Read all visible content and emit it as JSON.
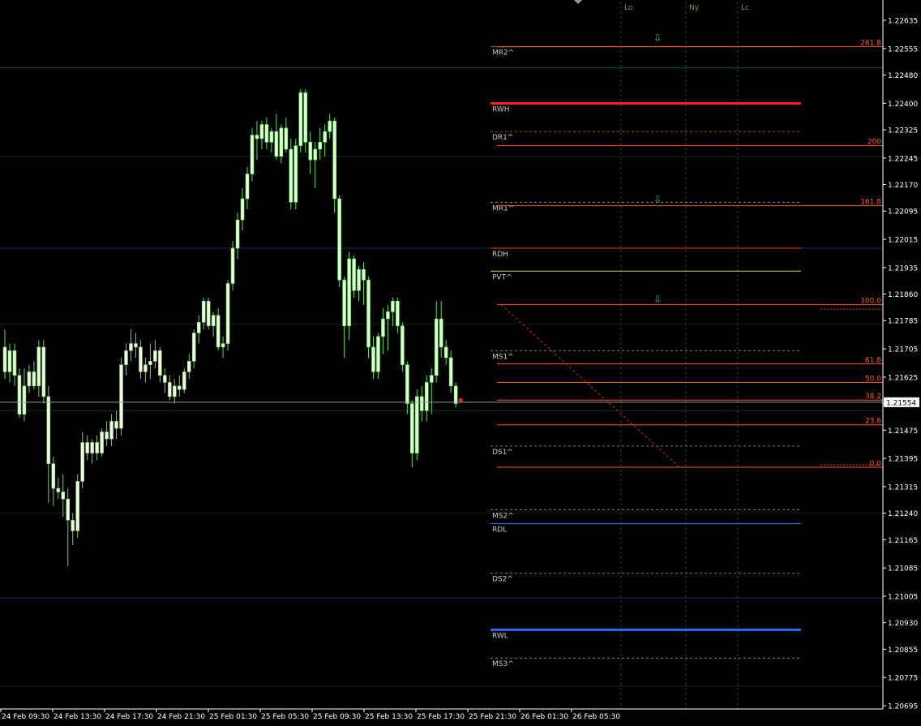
{
  "chart_data": {
    "type": "candlestick",
    "instrument_note": "",
    "price_axis": {
      "ticks": [
        "1.22635",
        "1.22555",
        "1.22480",
        "1.22400",
        "1.22325",
        "1.22245",
        "1.22170",
        "1.22095",
        "1.22015",
        "1.21935",
        "1.21860",
        "1.21785",
        "1.21705",
        "1.21625",
        "1.21550",
        "1.21475",
        "1.21395",
        "1.21315",
        "1.21240",
        "1.21165",
        "1.21085",
        "1.21005",
        "1.20930",
        "1.20855",
        "1.20775",
        "1.20695"
      ],
      "range": [
        1.20695,
        1.22635
      ]
    },
    "time_axis": {
      "ticks": [
        "24 Feb 09:30",
        "24 Feb 13:30",
        "24 Feb 17:30",
        "24 Feb 21:30",
        "25 Feb 01:30",
        "25 Feb 05:30",
        "25 Feb 09:30",
        "25 Feb 13:30",
        "25 Feb 17:30",
        "25 Feb 21:30",
        "26 Feb 01:30",
        "26 Feb 05:30"
      ]
    },
    "current_price": "1.21554",
    "candles": [
      [
        1.2171,
        1.2176,
        1.2162,
        1.2164
      ],
      [
        1.2164,
        1.2172,
        1.2161,
        1.217
      ],
      [
        1.217,
        1.2172,
        1.216,
        1.2163
      ],
      [
        1.2163,
        1.2165,
        1.2151,
        1.2152
      ],
      [
        1.2152,
        1.2165,
        1.215,
        1.216
      ],
      [
        1.216,
        1.2166,
        1.2158,
        1.2164
      ],
      [
        1.2164,
        1.2167,
        1.2159,
        1.216
      ],
      [
        1.216,
        1.2173,
        1.2157,
        1.2171
      ],
      [
        1.2171,
        1.2173,
        1.2155,
        1.2157
      ],
      [
        1.2157,
        1.216,
        1.2127,
        1.2138
      ],
      [
        1.2138,
        1.214,
        1.2126,
        1.2131
      ],
      [
        1.2131,
        1.2134,
        1.2128,
        1.213
      ],
      [
        1.213,
        1.2135,
        1.2123,
        1.2128
      ],
      [
        1.2128,
        1.2131,
        1.2109,
        1.2122
      ],
      [
        1.2122,
        1.2124,
        1.2115,
        1.2119
      ],
      [
        1.2119,
        1.2135,
        1.2117,
        1.2133
      ],
      [
        1.2133,
        1.2147,
        1.2131,
        1.2144
      ],
      [
        1.2144,
        1.2146,
        1.2139,
        1.2141
      ],
      [
        1.2141,
        1.2145,
        1.2138,
        1.2144
      ],
      [
        1.2144,
        1.2146,
        1.2139,
        1.2141
      ],
      [
        1.2141,
        1.2148,
        1.214,
        1.2147
      ],
      [
        1.2147,
        1.215,
        1.2143,
        1.2145
      ],
      [
        1.2145,
        1.2152,
        1.2143,
        1.215
      ],
      [
        1.215,
        1.2153,
        1.2145,
        1.2148
      ],
      [
        1.2148,
        1.2168,
        1.2146,
        1.2166
      ],
      [
        1.2166,
        1.2172,
        1.2163,
        1.217
      ],
      [
        1.217,
        1.2176,
        1.2167,
        1.2172
      ],
      [
        1.2172,
        1.2175,
        1.2168,
        1.2171
      ],
      [
        1.2171,
        1.2173,
        1.2162,
        1.2164
      ],
      [
        1.2164,
        1.2168,
        1.2161,
        1.2166
      ],
      [
        1.2166,
        1.2172,
        1.2162,
        1.2167
      ],
      [
        1.2167,
        1.2173,
        1.2165,
        1.217
      ],
      [
        1.217,
        1.2171,
        1.2161,
        1.2163
      ],
      [
        1.2163,
        1.2165,
        1.2158,
        1.2161
      ],
      [
        1.2161,
        1.2163,
        1.2156,
        1.2157
      ],
      [
        1.2157,
        1.2162,
        1.2155,
        1.216
      ],
      [
        1.216,
        1.2163,
        1.2157,
        1.2159
      ],
      [
        1.2159,
        1.2165,
        1.2158,
        1.2164
      ],
      [
        1.2164,
        1.2169,
        1.2162,
        1.2167
      ],
      [
        1.2167,
        1.2176,
        1.2165,
        1.2175
      ],
      [
        1.2175,
        1.218,
        1.2172,
        1.2178
      ],
      [
        1.2178,
        1.2185,
        1.2176,
        1.2184
      ],
      [
        1.2184,
        1.2185,
        1.2176,
        1.2177
      ],
      [
        1.2177,
        1.2181,
        1.2174,
        1.218
      ],
      [
        1.218,
        1.2182,
        1.217,
        1.2171
      ],
      [
        1.2171,
        1.2174,
        1.2168,
        1.2172
      ],
      [
        1.2172,
        1.219,
        1.217,
        1.2189
      ],
      [
        1.2189,
        1.2201,
        1.2187,
        1.2199
      ],
      [
        1.2199,
        1.2209,
        1.2196,
        1.2207
      ],
      [
        1.2207,
        1.2216,
        1.2204,
        1.2213
      ],
      [
        1.2213,
        1.2222,
        1.221,
        1.222
      ],
      [
        1.222,
        1.2233,
        1.2218,
        1.2231
      ],
      [
        1.2231,
        1.2235,
        1.2224,
        1.223
      ],
      [
        1.223,
        1.2235,
        1.2227,
        1.2234
      ],
      [
        1.2234,
        1.2236,
        1.2227,
        1.2229
      ],
      [
        1.2229,
        1.2233,
        1.2226,
        1.2232
      ],
      [
        1.2232,
        1.2237,
        1.2224,
        1.2225
      ],
      [
        1.2225,
        1.2234,
        1.2223,
        1.2233
      ],
      [
        1.2233,
        1.2236,
        1.2226,
        1.2227
      ],
      [
        1.2227,
        1.223,
        1.221,
        1.2212
      ],
      [
        1.2212,
        1.223,
        1.221,
        1.2228
      ],
      [
        1.2228,
        1.2244,
        1.2226,
        1.2243
      ],
      [
        1.2243,
        1.2244,
        1.2226,
        1.2229
      ],
      [
        1.2229,
        1.2232,
        1.222,
        1.2224
      ],
      [
        1.2224,
        1.2229,
        1.2216,
        1.2227
      ],
      [
        1.2227,
        1.2233,
        1.2224,
        1.2229
      ],
      [
        1.2229,
        1.2234,
        1.2225,
        1.2232
      ],
      [
        1.2232,
        1.2237,
        1.223,
        1.2235
      ],
      [
        1.2235,
        1.2236,
        1.2209,
        1.2213
      ],
      [
        1.2213,
        1.2214,
        1.2188,
        1.219
      ],
      [
        1.219,
        1.2191,
        1.2168,
        1.2177
      ],
      [
        1.2177,
        1.2198,
        1.2173,
        1.2196
      ],
      [
        1.2196,
        1.2197,
        1.2185,
        1.2187
      ],
      [
        1.2187,
        1.2194,
        1.2184,
        1.2193
      ],
      [
        1.2193,
        1.2195,
        1.2183,
        1.219
      ],
      [
        1.219,
        1.2191,
        1.2168,
        1.2171
      ],
      [
        1.2171,
        1.2174,
        1.2162,
        1.2164
      ],
      [
        1.2164,
        1.2175,
        1.2162,
        1.2174
      ],
      [
        1.2174,
        1.2182,
        1.2169,
        1.2179
      ],
      [
        1.2179,
        1.2183,
        1.217,
        1.2181
      ],
      [
        1.2181,
        1.2185,
        1.2177,
        1.2184
      ],
      [
        1.2184,
        1.2185,
        1.2175,
        1.2177
      ],
      [
        1.2177,
        1.2178,
        1.2164,
        1.2166
      ],
      [
        1.2166,
        1.2167,
        1.2152,
        1.2155
      ],
      [
        1.2155,
        1.2156,
        1.2137,
        1.2141
      ],
      [
        1.2141,
        1.2159,
        1.2139,
        1.2157
      ],
      [
        1.2157,
        1.216,
        1.215,
        1.2153
      ],
      [
        1.2153,
        1.2163,
        1.215,
        1.2161
      ],
      [
        1.2161,
        1.2165,
        1.2152,
        1.2163
      ],
      [
        1.2163,
        1.2184,
        1.2161,
        1.2179
      ],
      [
        1.2179,
        1.2184,
        1.2168,
        1.2171
      ],
      [
        1.2171,
        1.2173,
        1.2166,
        1.2168
      ],
      [
        1.2168,
        1.217,
        1.2158,
        1.216
      ],
      [
        1.216,
        1.2161,
        1.2154,
        1.2155
      ]
    ],
    "levels": [
      {
        "label": "MR2^",
        "price": 1.2256,
        "color": "#b85a32",
        "style": "solid",
        "width": 1
      },
      {
        "label": "RWH",
        "price": 1.224,
        "color": "#ff2222",
        "style": "solid",
        "width": 3
      },
      {
        "label": "DR1^",
        "price": 1.2232,
        "color": "#b83a28",
        "style": "dashed",
        "width": 1
      },
      {
        "label": "MR1^",
        "price": 1.2212,
        "color": "#8a8a70",
        "style": "dashed",
        "width": 1
      },
      {
        "label": "RDH",
        "price": 1.2199,
        "color": "#ff3333",
        "style": "solid",
        "width": 1
      },
      {
        "label": "PVT^",
        "price": 1.21925,
        "color": "#d8d050",
        "style": "solid",
        "width": 1
      },
      {
        "label": "MS1^",
        "price": 1.217,
        "color": "#8a8a70",
        "style": "dashed",
        "width": 1
      },
      {
        "label": "DS1^",
        "price": 1.2143,
        "color": "#6a72b0",
        "style": "dashed",
        "width": 1
      },
      {
        "label": "MS2^",
        "price": 1.2125,
        "color": "#8a8a70",
        "style": "dashed",
        "width": 1
      },
      {
        "label": "RDL",
        "price": 1.2121,
        "color": "#3a78ff",
        "style": "solid",
        "width": 1
      },
      {
        "label": "DS2^",
        "price": 1.2107,
        "color": "#6a72b0",
        "style": "dashed",
        "width": 1
      },
      {
        "label": "RWL",
        "price": 1.2091,
        "color": "#2a68ff",
        "style": "solid",
        "width": 3
      },
      {
        "label": "MS3^",
        "price": 1.2083,
        "color": "#8a8a70",
        "style": "dashed",
        "width": 1
      }
    ],
    "fib_levels": [
      {
        "label": "261.8",
        "price": 1.2256
      },
      {
        "label": "200",
        "price": 1.2228
      },
      {
        "label": "161.8",
        "price": 1.2211
      },
      {
        "label": "100.0",
        "price": 1.2183
      },
      {
        "label": "61.8",
        "price": 1.21663
      },
      {
        "label": "50.0",
        "price": 1.2161
      },
      {
        "label": "38.2",
        "price": 1.2156
      },
      {
        "label": "23.6",
        "price": 1.2149
      },
      {
        "label": "0.0",
        "price": 1.2137
      }
    ],
    "session_markers": [
      "Lo",
      "Ny",
      "Lc"
    ],
    "hlines": [
      {
        "price": 1.225,
        "color": "#0e5a0e"
      },
      {
        "price": 1.2225,
        "color": "#12262e"
      },
      {
        "price": 1.2199,
        "color": "#24246a"
      },
      {
        "price": 1.21775,
        "color": "#151d24"
      },
      {
        "price": 1.2153,
        "color": "#163416"
      },
      {
        "price": 1.2124,
        "color": "#142418"
      },
      {
        "price": 1.21,
        "color": "#24246a"
      },
      {
        "price": 1.2075,
        "color": "#142418"
      }
    ],
    "colors": {
      "background": "#000000",
      "bull": "#e8ffd8",
      "bear": "#e8ffd8",
      "wick": "#5fdc5f",
      "axis_text": "#ffffff",
      "fib": "#ff5a1a",
      "grid": "#333333"
    }
  }
}
